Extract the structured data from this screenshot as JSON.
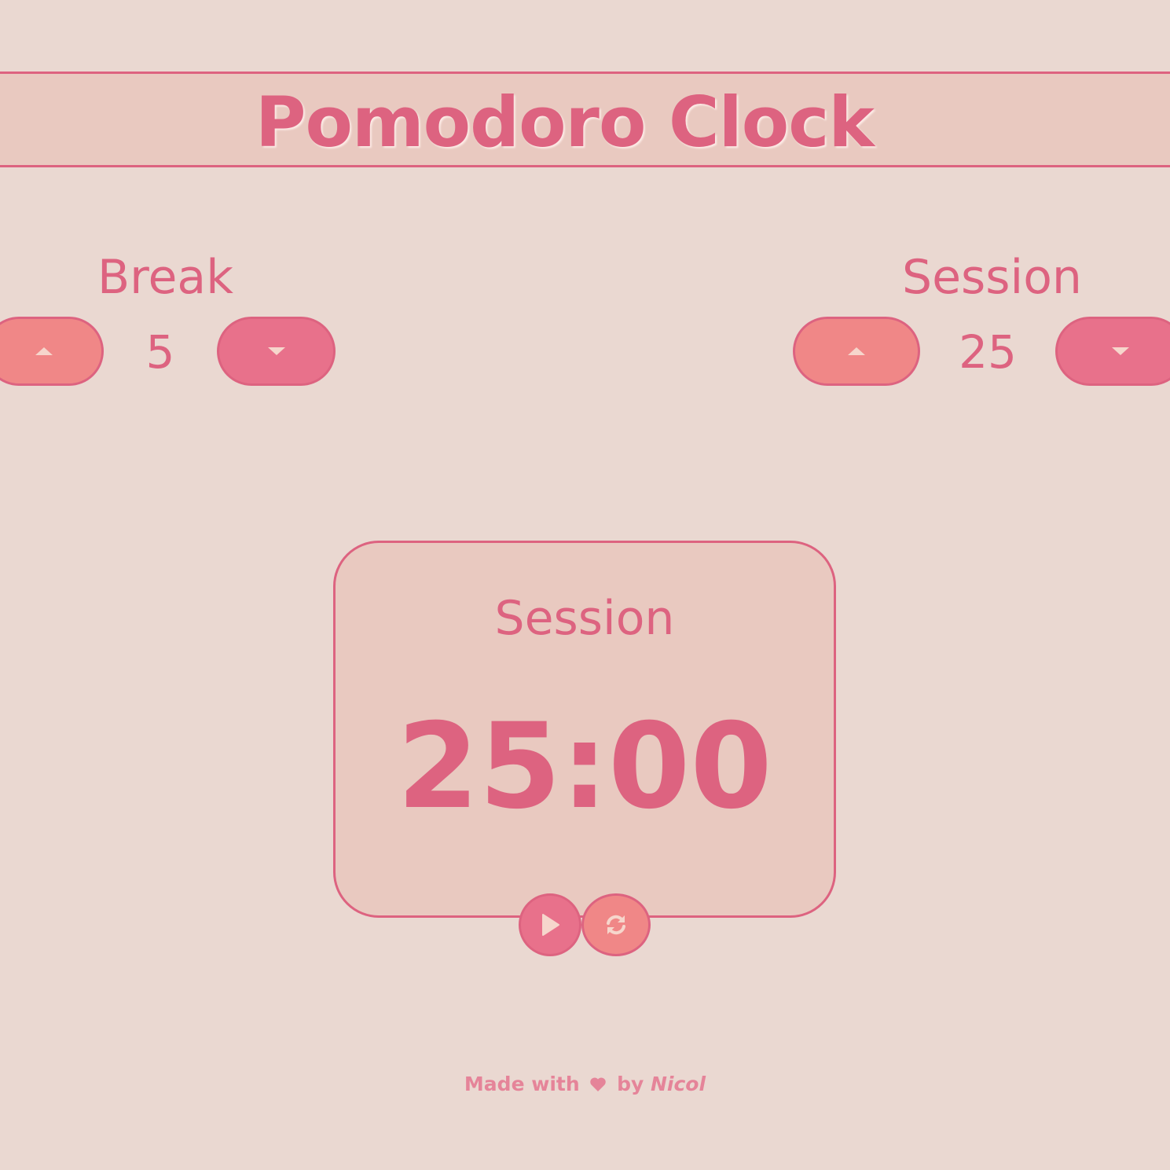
{
  "header": {
    "title": "Pomodoro Clock"
  },
  "break_control": {
    "label": "Break",
    "value": "5",
    "increment_icon": "caret-up-icon",
    "decrement_icon": "caret-down-icon"
  },
  "session_control": {
    "label": "Session",
    "value": "25",
    "increment_icon": "caret-up-icon",
    "decrement_icon": "caret-down-icon"
  },
  "timer": {
    "label": "Session",
    "time": "25:00",
    "play_icon": "play-icon",
    "reset_icon": "refresh-icon"
  },
  "footer": {
    "prefix": "Made with",
    "heart_icon": "heart-icon",
    "by": "by",
    "author": "Nicol"
  },
  "colors": {
    "background": "#ead8d1",
    "panel": "#e9c9c0",
    "accent": "#dd6380",
    "button_up": "#f08787",
    "button_down": "#e8718b",
    "icon_light": "#f6d6cc"
  }
}
